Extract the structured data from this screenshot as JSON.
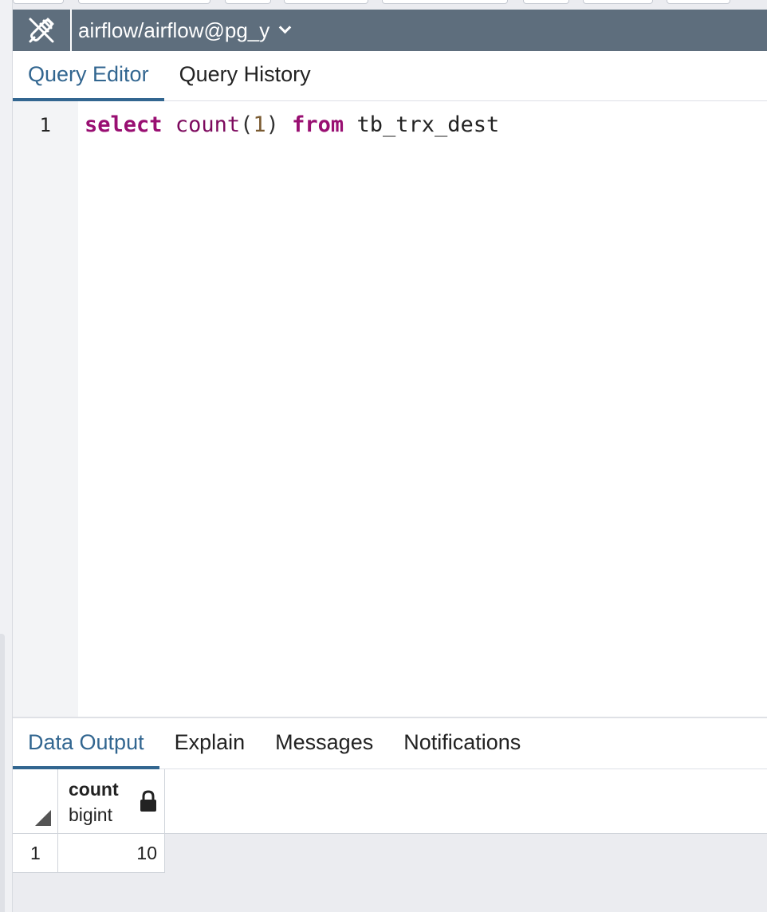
{
  "connection": {
    "label": "airflow/airflow@pg_y"
  },
  "editor_tabs": [
    {
      "label": "Query Editor",
      "active": true
    },
    {
      "label": "Query History",
      "active": false
    }
  ],
  "editor": {
    "line_number": "1",
    "tokens": {
      "kw_select": "select",
      "fn_count": "count",
      "open_paren": "(",
      "arg": "1",
      "close_paren": ")",
      "kw_from": "from",
      "table": "tb_trx_dest"
    }
  },
  "output_tabs": [
    {
      "label": "Data Output",
      "active": true
    },
    {
      "label": "Explain",
      "active": false
    },
    {
      "label": "Messages",
      "active": false
    },
    {
      "label": "Notifications",
      "active": false
    }
  ],
  "result": {
    "column": {
      "name": "count",
      "type": "bigint",
      "icon": "lock-icon"
    },
    "rows": [
      {
        "row_no": "1",
        "value": "10"
      }
    ]
  },
  "colors": {
    "connection_bar": "#5e6e7d",
    "active_tab": "#326690",
    "keyword": "#990f72"
  }
}
